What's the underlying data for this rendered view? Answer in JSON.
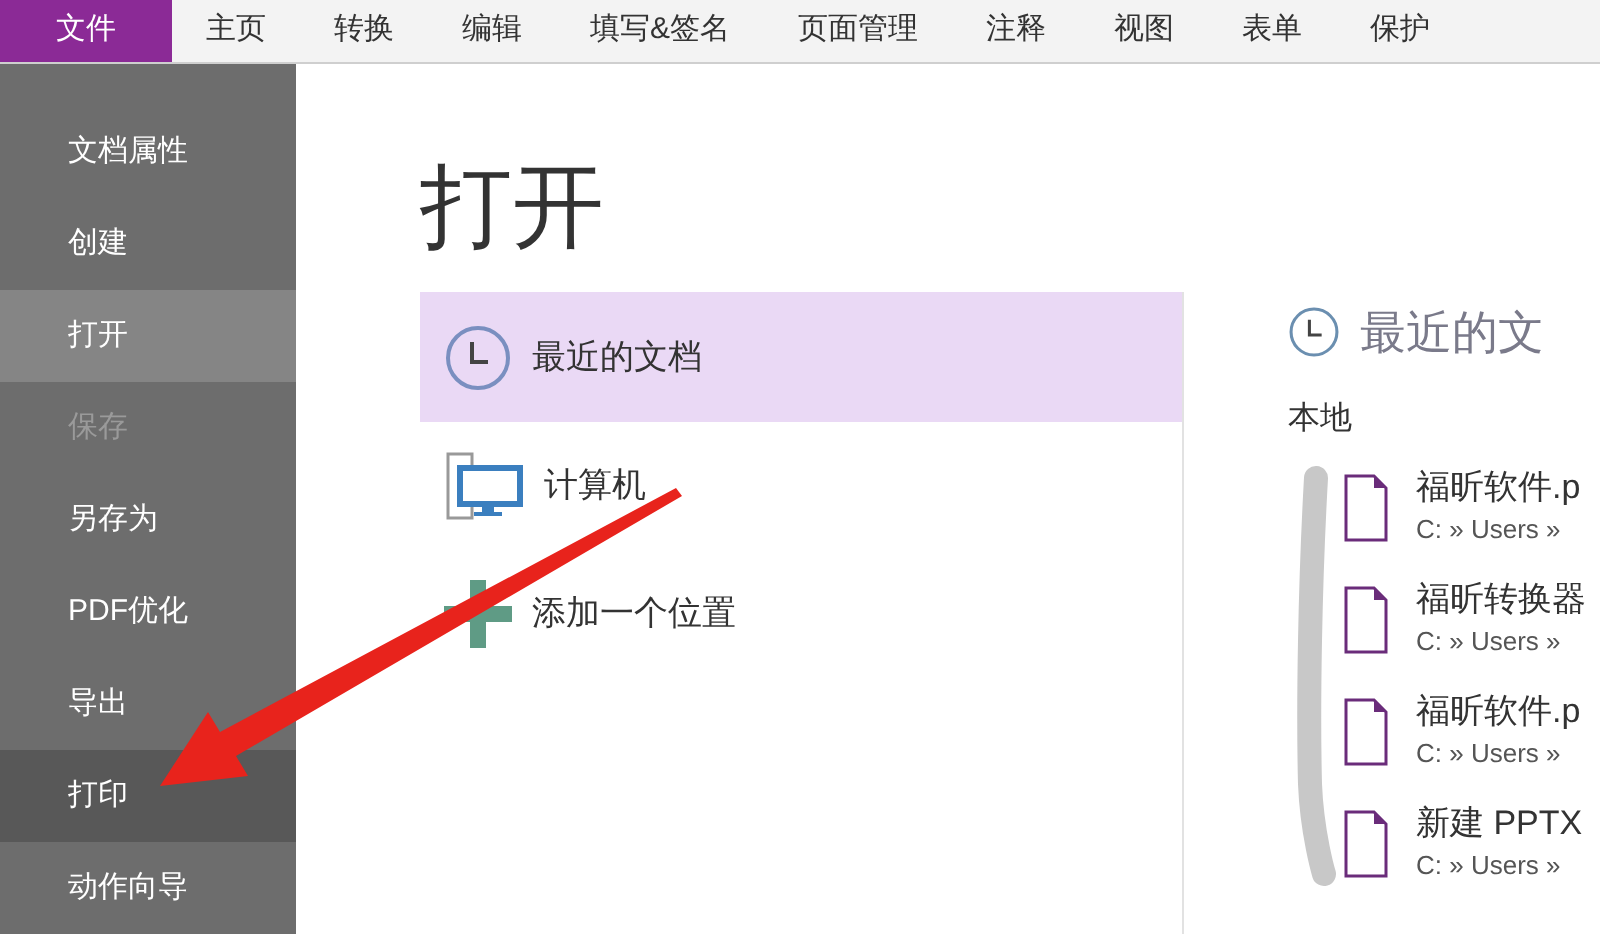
{
  "menu_tabs": [
    {
      "label": "文件",
      "selected": true
    },
    {
      "label": "主页",
      "selected": false
    },
    {
      "label": "转换",
      "selected": false
    },
    {
      "label": "编辑",
      "selected": false
    },
    {
      "label": "填写&签名",
      "selected": false
    },
    {
      "label": "页面管理",
      "selected": false
    },
    {
      "label": "注释",
      "selected": false
    },
    {
      "label": "视图",
      "selected": false
    },
    {
      "label": "表单",
      "selected": false
    },
    {
      "label": "保护",
      "selected": false
    }
  ],
  "sidebar": {
    "items": [
      {
        "label": "文档属性",
        "selected": false,
        "hovered": false,
        "disabled": false
      },
      {
        "label": "创建",
        "selected": false,
        "hovered": false,
        "disabled": false
      },
      {
        "label": "打开",
        "selected": true,
        "hovered": false,
        "disabled": false
      },
      {
        "label": "保存",
        "selected": false,
        "hovered": false,
        "disabled": true
      },
      {
        "label": "另存为",
        "selected": false,
        "hovered": false,
        "disabled": false
      },
      {
        "label": "PDF优化",
        "selected": false,
        "hovered": false,
        "disabled": false
      },
      {
        "label": "导出",
        "selected": false,
        "hovered": false,
        "disabled": false
      },
      {
        "label": "打印",
        "selected": false,
        "hovered": true,
        "disabled": false
      },
      {
        "label": "动作向导",
        "selected": false,
        "hovered": false,
        "disabled": false
      }
    ]
  },
  "page_title": "打开",
  "locations": [
    {
      "kind": "recent",
      "label": "最近的文档",
      "selected": true
    },
    {
      "kind": "computer",
      "label": "计算机",
      "selected": false
    },
    {
      "kind": "add",
      "label": "添加一个位置",
      "selected": false
    }
  ],
  "recent": {
    "heading": "最近的文",
    "group": "本地",
    "files": [
      {
        "name": "福昕软件.p",
        "path": "C: » Users »"
      },
      {
        "name": "福昕转换器",
        "path": "C: » Users »"
      },
      {
        "name": "福昕软件.p",
        "path": "C: » Users »"
      },
      {
        "name": "新建 PPTX",
        "path": "C: » Users »"
      }
    ]
  }
}
